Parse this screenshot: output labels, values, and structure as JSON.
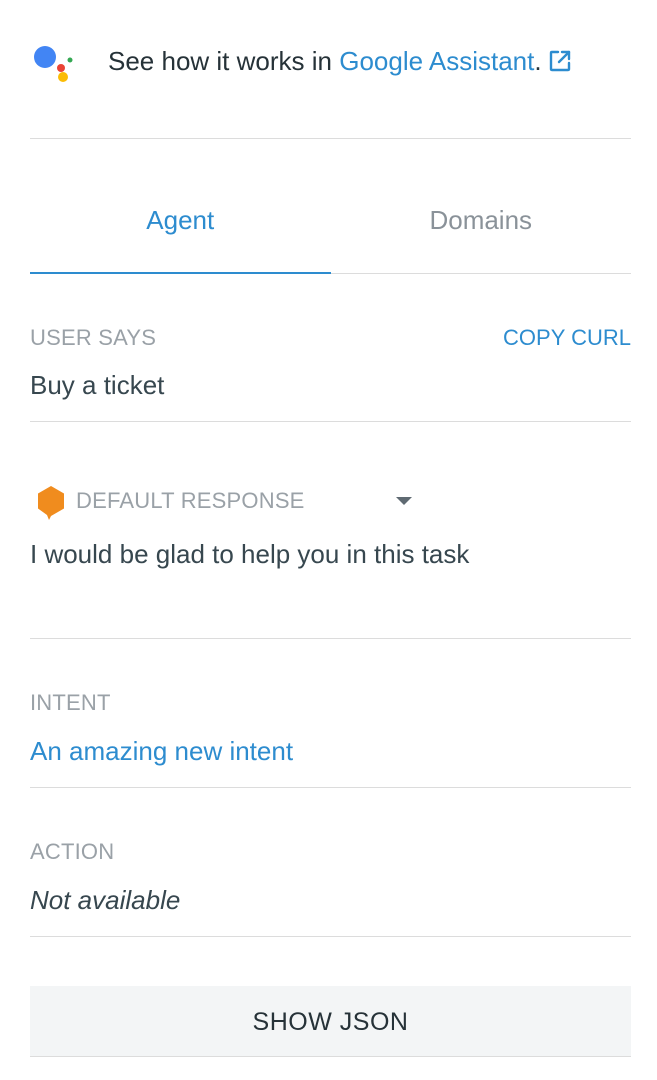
{
  "header": {
    "prefix_text": "See how it works in ",
    "link_text": "Google Assistant",
    "suffix_text": ".",
    "logo_icon": "google-assistant-logo",
    "link_icon": "external-link-icon",
    "logo_colors": {
      "blue": "#4285F4",
      "red": "#EA4335",
      "yellow": "#FBBC05",
      "green": "#34A853"
    }
  },
  "tabs": [
    {
      "label": "Agent",
      "active": true
    },
    {
      "label": "Domains",
      "active": false
    }
  ],
  "user_says": {
    "label": "USER SAYS",
    "value": "Buy a ticket",
    "copy_curl_label": "COPY CURL"
  },
  "response": {
    "label": "DEFAULT RESPONSE",
    "value": "I would be glad to help you in this task",
    "icon": "response-bubble-icon",
    "icon_color": "#F08C1E"
  },
  "intent": {
    "label": "INTENT",
    "value": "An amazing new intent"
  },
  "action": {
    "label": "ACTION",
    "value": "Not available"
  },
  "show_json_label": "SHOW JSON",
  "colors": {
    "accent": "#2D8CCF",
    "muted_text": "#9AA1A7",
    "body_text": "#37474F",
    "divider": "#DCDCDC",
    "button_bg": "#F3F5F6"
  }
}
